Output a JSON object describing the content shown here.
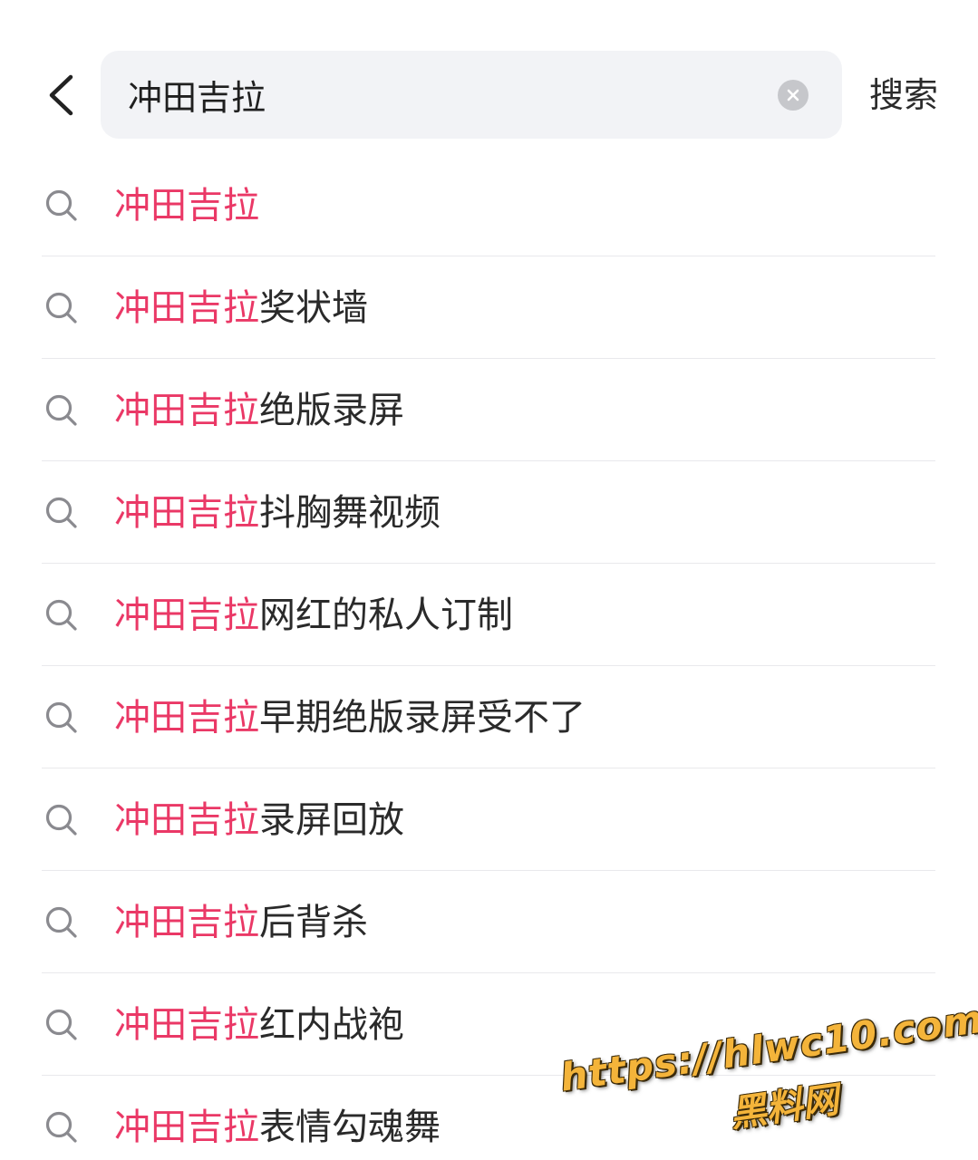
{
  "header": {
    "back_icon": "chevron-left-icon",
    "search": {
      "value": "冲田吉拉",
      "clear_icon": "clear-circle-icon"
    },
    "search_button_label": "搜索"
  },
  "colors": {
    "highlight": "#ea3866",
    "text": "#2a2a2a",
    "search_box_bg": "#f2f3f6",
    "divider": "#e9e9ec",
    "icon": "#8a8a8f"
  },
  "suggestions": [
    {
      "icon": "search-icon",
      "highlight": "冲田吉拉",
      "rest": ""
    },
    {
      "icon": "search-icon",
      "highlight": "冲田吉拉",
      "rest": "奖状墙"
    },
    {
      "icon": "search-icon",
      "highlight": "冲田吉拉",
      "rest": "绝版录屏"
    },
    {
      "icon": "search-icon",
      "highlight": "冲田吉拉",
      "rest": "抖胸舞视频"
    },
    {
      "icon": "search-icon",
      "highlight": "冲田吉拉",
      "rest": "网红的私人订制"
    },
    {
      "icon": "search-icon",
      "highlight": "冲田吉拉",
      "rest": "早期绝版录屏受不了"
    },
    {
      "icon": "search-icon",
      "highlight": "冲田吉拉",
      "rest": "录屏回放"
    },
    {
      "icon": "search-icon",
      "highlight": "冲田吉拉",
      "rest": "后背杀"
    },
    {
      "icon": "search-icon",
      "highlight": "冲田吉拉",
      "rest": "红内战袍"
    },
    {
      "icon": "search-icon",
      "highlight": "冲田吉拉",
      "rest": "表情勾魂舞"
    }
  ],
  "watermark": {
    "url": "https://hlwc10.com",
    "name": "黑料网"
  }
}
